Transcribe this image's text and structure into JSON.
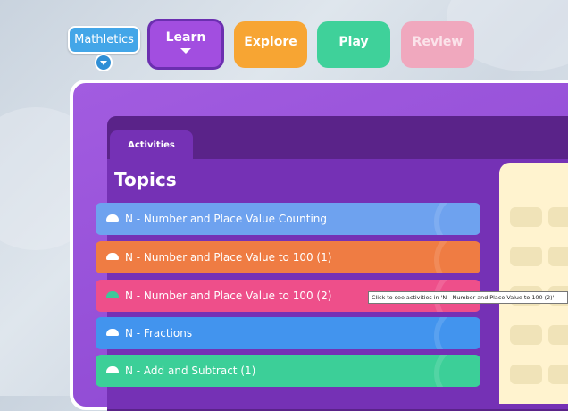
{
  "logo": {
    "text": "Mathletics"
  },
  "nav": {
    "learn": "Learn",
    "explore": "Explore",
    "play": "Play",
    "review": "Review"
  },
  "tabs": {
    "activities": "Activities"
  },
  "topics": {
    "title": "Topics",
    "items": [
      {
        "label": "N - Number and Place Value Counting",
        "color": "#6ea2ef"
      },
      {
        "label": "N - Number and Place Value to 100 (1)",
        "color": "#ef7c43"
      },
      {
        "label": "N - Number and Place Value to 100 (2)",
        "color": "#ee4f8a"
      },
      {
        "label": "N - Fractions",
        "color": "#4294ee"
      },
      {
        "label": "N - Add and Subtract (1)",
        "color": "#3ccf98"
      }
    ]
  },
  "tooltip": {
    "text": "Click to see activities in 'N - Number and Place Value to 100 (2)'"
  },
  "colors": {
    "board": "#9a52db",
    "panel": "#5a2389",
    "content": "#7531b5",
    "right_panel": "#fff3cf"
  }
}
